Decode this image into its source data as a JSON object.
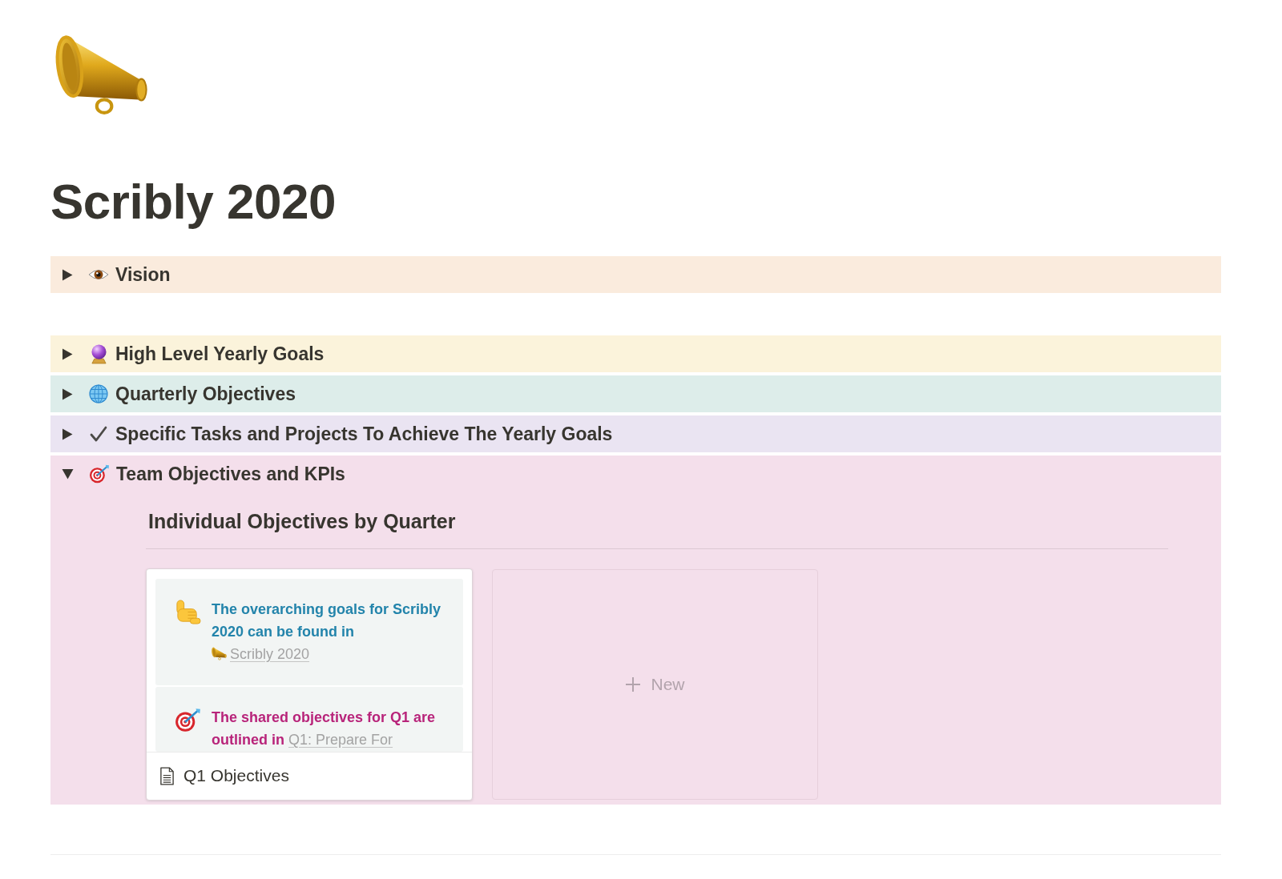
{
  "page": {
    "title": "Scribly 2020"
  },
  "toggles": [
    {
      "label": "Vision",
      "expanded": false,
      "color": "#faebdd"
    },
    {
      "label": "High Level Yearly Goals",
      "expanded": false,
      "color": "#fbf3db"
    },
    {
      "label": "Quarterly Objectives",
      "expanded": false,
      "color": "#ddedea"
    },
    {
      "label": "Specific Tasks and Projects To Achieve The Yearly Goals",
      "expanded": false,
      "color": "#eae4f2"
    },
    {
      "label": "Team Objectives and KPIs",
      "expanded": true,
      "color": "#f4dfeb",
      "board": {
        "title": "Individual Objectives by Quarter",
        "cards": [
          {
            "title": "Q1 Objectives",
            "callouts": [
              {
                "text": "The overarching goals for Scribly 2020 can be found in",
                "link": "Scribly 2020",
                "color": "#2384ab"
              },
              {
                "text": "The shared objectives for Q1 are outlined in",
                "link": "Q1: Prepare For",
                "color": "#b8247a"
              }
            ]
          }
        ],
        "new_card": "New"
      }
    }
  ]
}
